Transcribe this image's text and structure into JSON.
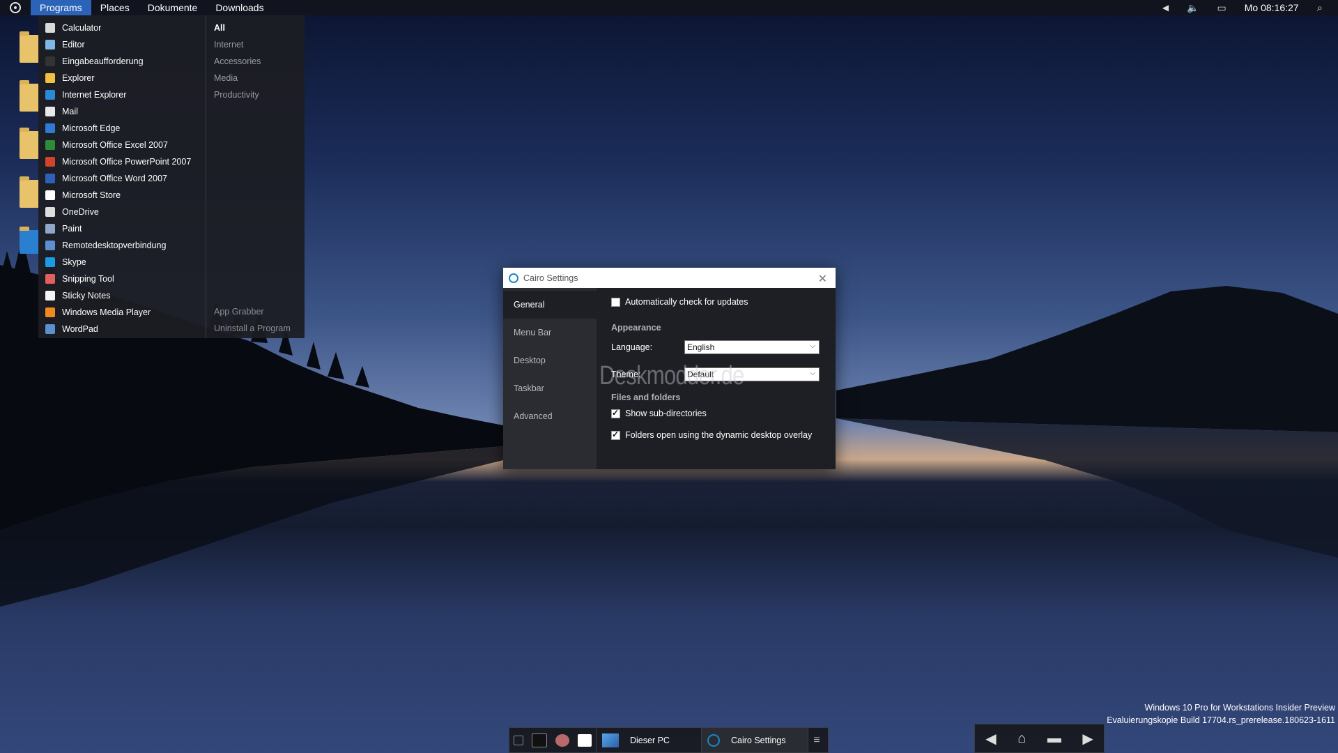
{
  "menubar": {
    "menus": [
      {
        "label": "Programs",
        "active": true
      },
      {
        "label": "Places",
        "active": false
      },
      {
        "label": "Dokumente",
        "active": false
      },
      {
        "label": "Downloads",
        "active": false
      }
    ],
    "clock": "Mo 08:16:27"
  },
  "programs": {
    "items": [
      {
        "label": "Calculator",
        "icon": "calculator-icon",
        "color": "#d9d9d9"
      },
      {
        "label": "Editor",
        "icon": "notepad-icon",
        "color": "#7fb6e6"
      },
      {
        "label": "Eingabeaufforderung",
        "icon": "cmd-icon",
        "color": "#333333"
      },
      {
        "label": "Explorer",
        "icon": "folder-icon",
        "color": "#f0c040"
      },
      {
        "label": "Internet Explorer",
        "icon": "ie-icon",
        "color": "#2a8ad8"
      },
      {
        "label": "Mail",
        "icon": "mail-icon",
        "color": "#e8e8e8"
      },
      {
        "label": "Microsoft Edge",
        "icon": "edge-icon",
        "color": "#2f7ad6"
      },
      {
        "label": "Microsoft Office Excel 2007",
        "icon": "excel-icon",
        "color": "#2e8b3a"
      },
      {
        "label": "Microsoft Office PowerPoint 2007",
        "icon": "powerpoint-icon",
        "color": "#d0452a"
      },
      {
        "label": "Microsoft Office Word 2007",
        "icon": "word-icon",
        "color": "#2f5fb8"
      },
      {
        "label": "Microsoft Store",
        "icon": "store-icon",
        "color": "#ffffff"
      },
      {
        "label": "OneDrive",
        "icon": "onedrive-icon",
        "color": "#dddddd"
      },
      {
        "label": "Paint",
        "icon": "paint-icon",
        "color": "#8fa7c8"
      },
      {
        "label": "Remotedesktopverbindung",
        "icon": "remote-desktop-icon",
        "color": "#5d8fd0"
      },
      {
        "label": "Skype",
        "icon": "skype-icon",
        "color": "#1a9be6"
      },
      {
        "label": "Snipping Tool",
        "icon": "snipping-icon",
        "color": "#e06060"
      },
      {
        "label": "Sticky Notes",
        "icon": "sticky-notes-icon",
        "color": "#f4f4f4"
      },
      {
        "label": "Windows Media Player",
        "icon": "media-player-icon",
        "color": "#f08a20"
      },
      {
        "label": "WordPad",
        "icon": "wordpad-icon",
        "color": "#5d8fd0"
      }
    ],
    "categories": [
      {
        "label": "All",
        "selected": true
      },
      {
        "label": "Internet",
        "selected": false
      },
      {
        "label": "Accessories",
        "selected": false
      },
      {
        "label": "Media",
        "selected": false
      },
      {
        "label": "Productivity",
        "selected": false
      }
    ],
    "footer": [
      "App Grabber",
      "Uninstall a Program"
    ]
  },
  "settings": {
    "title": "Cairo Settings",
    "nav": [
      {
        "label": "General",
        "selected": true
      },
      {
        "label": "Menu Bar",
        "selected": false
      },
      {
        "label": "Desktop",
        "selected": false
      },
      {
        "label": "Taskbar",
        "selected": false
      },
      {
        "label": "Advanced",
        "selected": false
      }
    ],
    "auto_update": {
      "label": "Automatically check for updates",
      "checked": false
    },
    "appearance": {
      "heading": "Appearance",
      "language_label": "Language:",
      "language_value": "English",
      "theme_label": "Theme:",
      "theme_value": "Default"
    },
    "files": {
      "heading": "Files and folders",
      "subdirs": {
        "label": "Show sub-directories",
        "checked": true
      },
      "overlay": {
        "label": "Folders open using the dynamic desktop overlay",
        "checked": true
      }
    }
  },
  "watermark_text": "Deskmodder.de",
  "build_info": {
    "line1": "Windows 10 Pro for Workstations Insider Preview",
    "line2": "Evaluierungskopie Build 17704.rs_prerelease.180623-1611"
  },
  "taskbar": {
    "tasks": [
      {
        "label": "Dieser PC",
        "icon": "computer-icon"
      },
      {
        "label": "Cairo Settings",
        "icon": "cairo-icon"
      }
    ]
  },
  "colors": {
    "accent": "#2a63b8",
    "panel": "#1e1f24"
  }
}
